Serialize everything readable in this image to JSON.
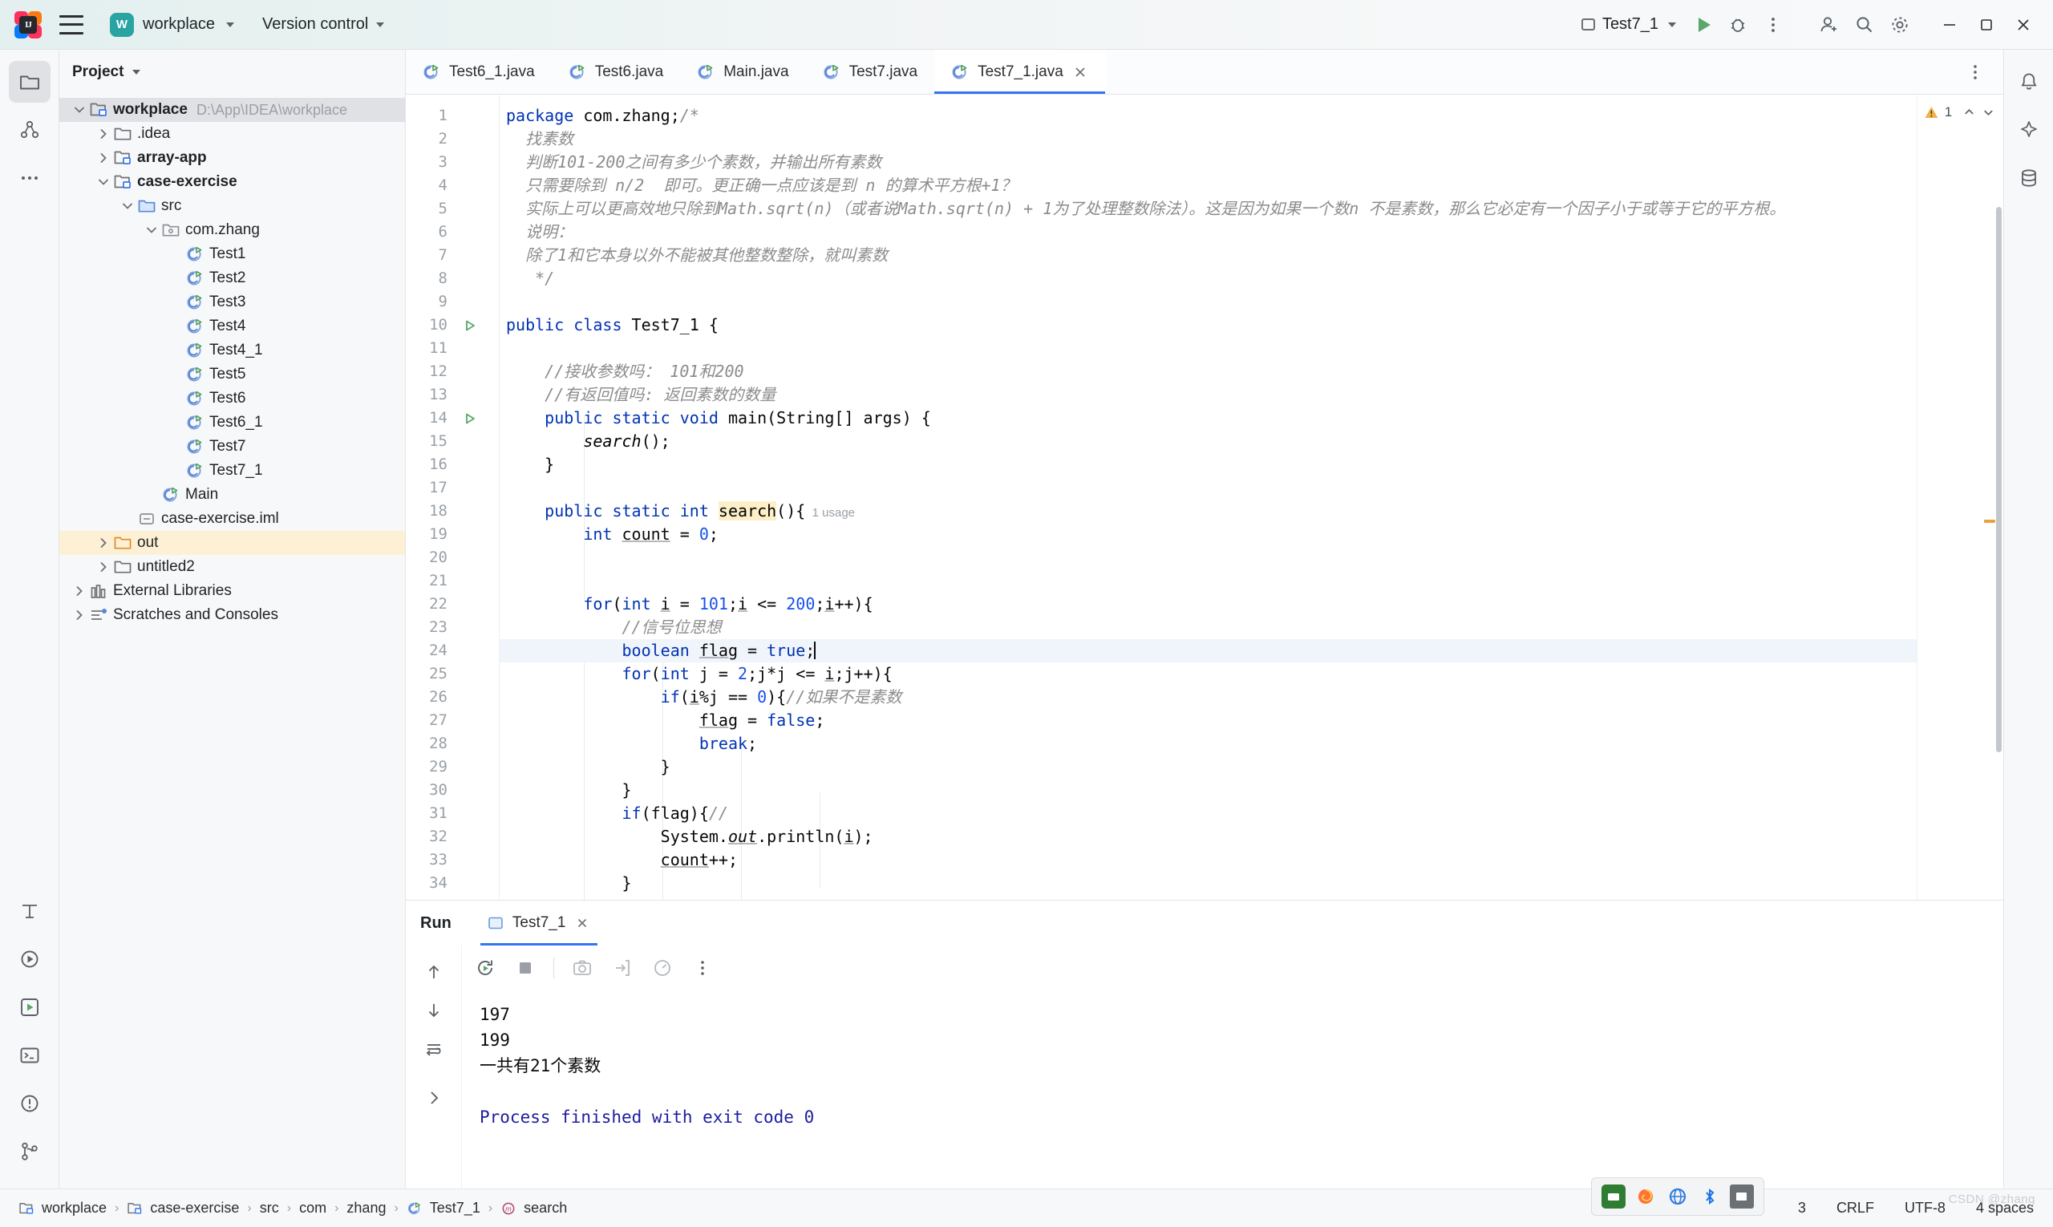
{
  "titlebar": {
    "logo_text": "IJ",
    "project_badge": "W",
    "project_name": "workplace",
    "version_control": "Version control",
    "run_config": "Test7_1",
    "icons": {
      "menu": "hamburger-icon",
      "run": "run-icon",
      "debug": "debug-icon",
      "more": "more-vertical-icon",
      "account": "account-icon",
      "search": "search-icon",
      "settings": "gear-icon",
      "minimize": "minimize-icon",
      "maximize": "maximize-icon",
      "close": "close-icon"
    }
  },
  "project_panel": {
    "title": "Project",
    "tree": [
      {
        "label": "workplace",
        "path": "D:\\App\\IDEA\\workplace",
        "depth": 0,
        "arrow": "down",
        "icon": "module-icon",
        "bold": true,
        "state": "selected"
      },
      {
        "label": ".idea",
        "depth": 1,
        "arrow": "right",
        "icon": "folder-icon",
        "bold": false,
        "state": ""
      },
      {
        "label": "array-app",
        "depth": 1,
        "arrow": "right",
        "icon": "module-icon",
        "bold": true,
        "state": ""
      },
      {
        "label": "case-exercise",
        "depth": 1,
        "arrow": "down",
        "icon": "module-icon",
        "bold": true,
        "state": ""
      },
      {
        "label": "src",
        "depth": 2,
        "arrow": "down",
        "icon": "src-folder-icon",
        "bold": false,
        "state": ""
      },
      {
        "label": "com.zhang",
        "depth": 3,
        "arrow": "down",
        "icon": "package-icon",
        "bold": false,
        "state": ""
      },
      {
        "label": "Test1",
        "depth": 4,
        "arrow": "",
        "icon": "java-class-icon",
        "bold": false,
        "state": ""
      },
      {
        "label": "Test2",
        "depth": 4,
        "arrow": "",
        "icon": "java-class-icon",
        "bold": false,
        "state": ""
      },
      {
        "label": "Test3",
        "depth": 4,
        "arrow": "",
        "icon": "java-class-icon",
        "bold": false,
        "state": ""
      },
      {
        "label": "Test4",
        "depth": 4,
        "arrow": "",
        "icon": "java-class-icon",
        "bold": false,
        "state": ""
      },
      {
        "label": "Test4_1",
        "depth": 4,
        "arrow": "",
        "icon": "java-class-icon",
        "bold": false,
        "state": ""
      },
      {
        "label": "Test5",
        "depth": 4,
        "arrow": "",
        "icon": "java-class-icon",
        "bold": false,
        "state": ""
      },
      {
        "label": "Test6",
        "depth": 4,
        "arrow": "",
        "icon": "java-class-icon",
        "bold": false,
        "state": ""
      },
      {
        "label": "Test6_1",
        "depth": 4,
        "arrow": "",
        "icon": "java-class-icon",
        "bold": false,
        "state": ""
      },
      {
        "label": "Test7",
        "depth": 4,
        "arrow": "",
        "icon": "java-class-icon",
        "bold": false,
        "state": ""
      },
      {
        "label": "Test7_1",
        "depth": 4,
        "arrow": "",
        "icon": "java-class-icon",
        "bold": false,
        "state": ""
      },
      {
        "label": "Main",
        "depth": 3,
        "arrow": "",
        "icon": "java-class-icon",
        "bold": false,
        "state": ""
      },
      {
        "label": "case-exercise.iml",
        "depth": 2,
        "arrow": "",
        "icon": "iml-file-icon",
        "bold": false,
        "state": ""
      },
      {
        "label": "out",
        "depth": 1,
        "arrow": "right",
        "icon": "excluded-folder-icon",
        "bold": false,
        "state": "highlighted"
      },
      {
        "label": "untitled2",
        "depth": 1,
        "arrow": "right",
        "icon": "folder-icon",
        "bold": false,
        "state": ""
      },
      {
        "label": "External Libraries",
        "depth": 0,
        "arrow": "right",
        "icon": "libraries-icon",
        "bold": false,
        "state": ""
      },
      {
        "label": "Scratches and Consoles",
        "depth": 0,
        "arrow": "right",
        "icon": "scratches-icon",
        "bold": false,
        "state": ""
      }
    ]
  },
  "editor": {
    "tabs": [
      {
        "label": "Test6_1.java",
        "active": false
      },
      {
        "label": "Test6.java",
        "active": false
      },
      {
        "label": "Main.java",
        "active": false
      },
      {
        "label": "Test7.java",
        "active": false
      },
      {
        "label": "Test7_1.java",
        "active": true
      }
    ],
    "warning_count": "1",
    "lines": [
      {
        "n": "1",
        "gutter": "",
        "cur": false,
        "tokens": [
          {
            "t": "package",
            "c": "k"
          },
          {
            "t": " com.zhang;",
            "c": "plain"
          },
          {
            "t": "/*",
            "c": "cm"
          }
        ]
      },
      {
        "n": "2",
        "gutter": "",
        "cur": false,
        "tokens": [
          {
            "t": "  找素数",
            "c": "cm"
          }
        ]
      },
      {
        "n": "3",
        "gutter": "",
        "cur": false,
        "tokens": [
          {
            "t": "  判断101-200之间有多少个素数，并输出所有素数",
            "c": "cm"
          }
        ]
      },
      {
        "n": "4",
        "gutter": "",
        "cur": false,
        "tokens": [
          {
            "t": "  只需要除到 n/2  即可。更正确一点应该是到 n 的算术平方根+1？",
            "c": "cm"
          }
        ]
      },
      {
        "n": "5",
        "gutter": "",
        "cur": false,
        "tokens": [
          {
            "t": "  实际上可以更高效地只除到Math.sqrt(n)（或者说Math.sqrt(n) + 1为了处理整数除法）。这是因为如果一个数n 不是素数，那么它必定有一个因子小于或等于它的平方根。",
            "c": "cm"
          }
        ]
      },
      {
        "n": "6",
        "gutter": "",
        "cur": false,
        "tokens": [
          {
            "t": "  说明：",
            "c": "cm"
          }
        ]
      },
      {
        "n": "7",
        "gutter": "",
        "cur": false,
        "tokens": [
          {
            "t": "  除了1和它本身以外不能被其他整数整除，就叫素数",
            "c": "cm"
          }
        ]
      },
      {
        "n": "8",
        "gutter": "",
        "cur": false,
        "tokens": [
          {
            "t": "   */",
            "c": "cm"
          }
        ]
      },
      {
        "n": "9",
        "gutter": "",
        "cur": false,
        "tokens": []
      },
      {
        "n": "10",
        "gutter": "run",
        "cur": false,
        "tokens": [
          {
            "t": "public class ",
            "c": "k"
          },
          {
            "t": "Test7_1 {",
            "c": "plain"
          }
        ]
      },
      {
        "n": "11",
        "gutter": "",
        "cur": false,
        "tokens": []
      },
      {
        "n": "12",
        "gutter": "",
        "cur": false,
        "tokens": [
          {
            "t": "    //接收参数吗： 101和200",
            "c": "cm"
          }
        ]
      },
      {
        "n": "13",
        "gutter": "",
        "cur": false,
        "tokens": [
          {
            "t": "    //有返回值吗: 返回素数的数量",
            "c": "cm"
          }
        ]
      },
      {
        "n": "14",
        "gutter": "run",
        "cur": false,
        "tokens": [
          {
            "t": "    ",
            "c": "plain"
          },
          {
            "t": "public static void ",
            "c": "k"
          },
          {
            "t": "main(String[] args) {",
            "c": "plain"
          }
        ]
      },
      {
        "n": "15",
        "gutter": "",
        "cur": false,
        "tokens": [
          {
            "t": "        ",
            "c": "plain"
          },
          {
            "t": "search",
            "c": "ital"
          },
          {
            "t": "();",
            "c": "plain"
          }
        ]
      },
      {
        "n": "16",
        "gutter": "",
        "cur": false,
        "tokens": [
          {
            "t": "    }",
            "c": "plain"
          }
        ]
      },
      {
        "n": "17",
        "gutter": "",
        "cur": false,
        "tokens": []
      },
      {
        "n": "18",
        "gutter": "",
        "cur": false,
        "tokens": [
          {
            "t": "    ",
            "c": "plain"
          },
          {
            "t": "public static int ",
            "c": "k"
          },
          {
            "t": "search",
            "c": "fn-hl"
          },
          {
            "t": "(){",
            "c": "plain"
          },
          {
            "t": "  1 usage",
            "c": "usage"
          }
        ]
      },
      {
        "n": "19",
        "gutter": "",
        "cur": false,
        "tokens": [
          {
            "t": "        ",
            "c": "plain"
          },
          {
            "t": "int ",
            "c": "k"
          },
          {
            "t": "count",
            "c": "field"
          },
          {
            "t": " = ",
            "c": "plain"
          },
          {
            "t": "0",
            "c": "num"
          },
          {
            "t": ";",
            "c": "plain"
          }
        ]
      },
      {
        "n": "20",
        "gutter": "",
        "cur": false,
        "tokens": []
      },
      {
        "n": "21",
        "gutter": "",
        "cur": false,
        "tokens": []
      },
      {
        "n": "22",
        "gutter": "",
        "cur": false,
        "tokens": [
          {
            "t": "        ",
            "c": "plain"
          },
          {
            "t": "for",
            "c": "k"
          },
          {
            "t": "(",
            "c": "plain"
          },
          {
            "t": "int ",
            "c": "k"
          },
          {
            "t": "i",
            "c": "field"
          },
          {
            "t": " = ",
            "c": "plain"
          },
          {
            "t": "101",
            "c": "num"
          },
          {
            "t": ";",
            "c": "plain"
          },
          {
            "t": "i",
            "c": "field"
          },
          {
            "t": " <= ",
            "c": "plain"
          },
          {
            "t": "200",
            "c": "num"
          },
          {
            "t": ";",
            "c": "plain"
          },
          {
            "t": "i",
            "c": "field"
          },
          {
            "t": "++){",
            "c": "plain"
          }
        ]
      },
      {
        "n": "23",
        "gutter": "",
        "cur": false,
        "tokens": [
          {
            "t": "            //信号位思想",
            "c": "cm"
          }
        ]
      },
      {
        "n": "24",
        "gutter": "",
        "cur": true,
        "tokens": [
          {
            "t": "            ",
            "c": "plain"
          },
          {
            "t": "boolean ",
            "c": "k"
          },
          {
            "t": "flag",
            "c": "field"
          },
          {
            "t": " = ",
            "c": "plain"
          },
          {
            "t": "true",
            "c": "k"
          },
          {
            "t": ";",
            "c": "plain"
          },
          {
            "t": "|",
            "c": "caret"
          }
        ]
      },
      {
        "n": "25",
        "gutter": "",
        "cur": false,
        "tokens": [
          {
            "t": "            ",
            "c": "plain"
          },
          {
            "t": "for",
            "c": "k"
          },
          {
            "t": "(",
            "c": "plain"
          },
          {
            "t": "int ",
            "c": "k"
          },
          {
            "t": "j",
            "c": "plain"
          },
          {
            "t": " = ",
            "c": "plain"
          },
          {
            "t": "2",
            "c": "num"
          },
          {
            "t": ";",
            "c": "plain"
          },
          {
            "t": "j*j <= ",
            "c": "plain"
          },
          {
            "t": "i",
            "c": "field"
          },
          {
            "t": ";",
            "c": "plain"
          },
          {
            "t": "j++){",
            "c": "plain"
          }
        ]
      },
      {
        "n": "26",
        "gutter": "",
        "cur": false,
        "tokens": [
          {
            "t": "                ",
            "c": "plain"
          },
          {
            "t": "if",
            "c": "k"
          },
          {
            "t": "(",
            "c": "plain"
          },
          {
            "t": "i",
            "c": "field"
          },
          {
            "t": "%j == ",
            "c": "plain"
          },
          {
            "t": "0",
            "c": "num"
          },
          {
            "t": "){",
            "c": "plain"
          },
          {
            "t": "//如果不是素数",
            "c": "cm"
          }
        ]
      },
      {
        "n": "27",
        "gutter": "",
        "cur": false,
        "tokens": [
          {
            "t": "                    ",
            "c": "plain"
          },
          {
            "t": "flag",
            "c": "field"
          },
          {
            "t": " = ",
            "c": "plain"
          },
          {
            "t": "false",
            "c": "k"
          },
          {
            "t": ";",
            "c": "plain"
          }
        ]
      },
      {
        "n": "28",
        "gutter": "",
        "cur": false,
        "tokens": [
          {
            "t": "                    ",
            "c": "plain"
          },
          {
            "t": "break",
            "c": "k"
          },
          {
            "t": ";",
            "c": "plain"
          }
        ]
      },
      {
        "n": "29",
        "gutter": "",
        "cur": false,
        "tokens": [
          {
            "t": "                }",
            "c": "plain"
          }
        ]
      },
      {
        "n": "30",
        "gutter": "",
        "cur": false,
        "tokens": [
          {
            "t": "            }",
            "c": "plain"
          }
        ]
      },
      {
        "n": "31",
        "gutter": "",
        "cur": false,
        "tokens": [
          {
            "t": "            ",
            "c": "plain"
          },
          {
            "t": "if",
            "c": "k"
          },
          {
            "t": "(flag){",
            "c": "plain"
          },
          {
            "t": "//",
            "c": "cm"
          }
        ]
      },
      {
        "n": "32",
        "gutter": "",
        "cur": false,
        "tokens": [
          {
            "t": "                System.",
            "c": "plain"
          },
          {
            "t": "out",
            "c": "ital-field"
          },
          {
            "t": ".println(",
            "c": "plain"
          },
          {
            "t": "i",
            "c": "field"
          },
          {
            "t": ");",
            "c": "plain"
          }
        ]
      },
      {
        "n": "33",
        "gutter": "",
        "cur": false,
        "tokens": [
          {
            "t": "                ",
            "c": "plain"
          },
          {
            "t": "count",
            "c": "field"
          },
          {
            "t": "++;",
            "c": "plain"
          }
        ]
      },
      {
        "n": "34",
        "gutter": "",
        "cur": false,
        "tokens": [
          {
            "t": "            }",
            "c": "plain"
          }
        ]
      }
    ]
  },
  "run_panel": {
    "label": "Run",
    "tab_label": "Test7_1",
    "toolbar_icons": [
      "rerun-icon",
      "stop-icon",
      "camera-icon",
      "export-icon",
      "profiler-icon",
      "more-vertical-icon"
    ],
    "side_icons": [
      "scroll-up-icon",
      "scroll-down-icon",
      "soft-wrap-icon",
      "expand-icon"
    ],
    "output": [
      {
        "text": "197",
        "style": "normal"
      },
      {
        "text": "199",
        "style": "normal"
      },
      {
        "text": "一共有21个素数",
        "style": "normal"
      },
      {
        "text": "",
        "style": "normal"
      },
      {
        "text": "Process finished with exit code 0",
        "style": "blue"
      }
    ]
  },
  "status_bar": {
    "breadcrumbs": [
      {
        "label": "workplace",
        "icon": "module-icon"
      },
      {
        "label": "case-exercise",
        "icon": "module-icon"
      },
      {
        "label": "src",
        "icon": ""
      },
      {
        "label": "com",
        "icon": ""
      },
      {
        "label": "zhang",
        "icon": ""
      },
      {
        "label": "Test7_1",
        "icon": "java-class-icon"
      },
      {
        "label": "search",
        "icon": "method-icon"
      }
    ],
    "right_items": [
      {
        "label": "3",
        "name": "line-column-indicator"
      },
      {
        "label": "CRLF",
        "name": "line-separator-indicator"
      },
      {
        "label": "UTF-8",
        "name": "encoding-indicator"
      },
      {
        "label": "4 spaces",
        "name": "indent-indicator"
      }
    ]
  },
  "tray": {
    "icons": [
      "input-method-icon",
      "firefox-icon",
      "browser-icon",
      "bluetooth-icon",
      "battery-icon"
    ]
  },
  "watermark": "CSDN @zhang"
}
